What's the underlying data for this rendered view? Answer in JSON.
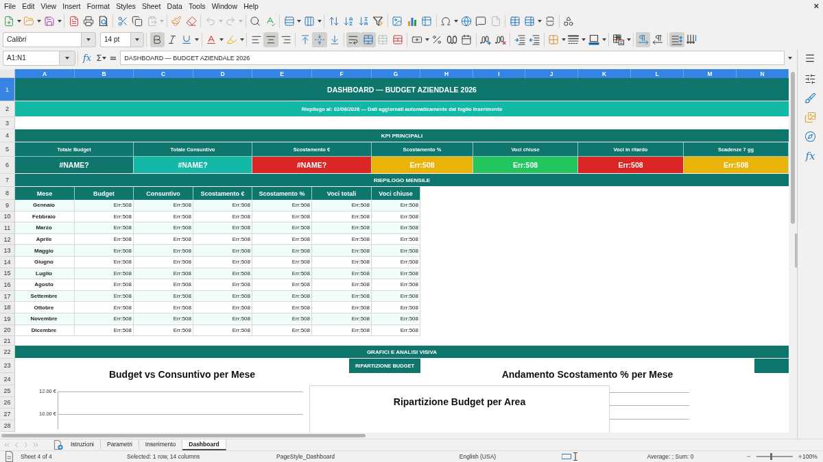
{
  "menu_bar": {
    "items": [
      "File",
      "Edit",
      "View",
      "Insert",
      "Format",
      "Styles",
      "Sheet",
      "Data",
      "Tools",
      "Window",
      "Help"
    ],
    "close_glyph": "×"
  },
  "toolbars": [
    {
      "groups": [
        {
          "items": [
            {
              "kind": "new",
              "dropdown": true,
              "active": false,
              "disabled": false
            },
            {
              "kind": "open",
              "dropdown": true,
              "active": false,
              "disabled": false
            },
            {
              "kind": "save",
              "dropdown": true,
              "active": false,
              "disabled": false
            }
          ]
        },
        {
          "items": [
            {
              "kind": "export_pdf",
              "dropdown": false,
              "active": false,
              "disabled": false
            },
            {
              "kind": "print",
              "dropdown": false,
              "active": false,
              "disabled": false
            },
            {
              "kind": "print_preview",
              "dropdown": false,
              "active": false,
              "disabled": false
            }
          ]
        },
        {
          "items": [
            {
              "kind": "cut",
              "dropdown": false,
              "active": false,
              "disabled": false
            },
            {
              "kind": "copy",
              "dropdown": false,
              "active": false,
              "disabled": false
            },
            {
              "kind": "paste",
              "dropdown": true,
              "active": false,
              "disabled": true
            }
          ]
        },
        {
          "items": [
            {
              "kind": "clone_formatting",
              "dropdown": false,
              "active": false,
              "disabled": false
            },
            {
              "kind": "clear_formatting",
              "dropdown": false,
              "active": false,
              "disabled": false
            }
          ]
        },
        {
          "items": [
            {
              "kind": "undo",
              "dropdown": true,
              "active": false,
              "disabled": true
            },
            {
              "kind": "redo",
              "dropdown": true,
              "active": false,
              "disabled": true
            }
          ]
        },
        {
          "items": [
            {
              "kind": "find_replace",
              "dropdown": false,
              "active": false,
              "disabled": false
            },
            {
              "kind": "spelling",
              "dropdown": false,
              "active": false,
              "disabled": false
            }
          ]
        },
        {
          "items": [
            {
              "kind": "row",
              "dropdown": true,
              "active": false,
              "disabled": false
            },
            {
              "kind": "column",
              "dropdown": true,
              "active": false,
              "disabled": false
            }
          ]
        },
        {
          "items": [
            {
              "kind": "sort",
              "dropdown": false,
              "active": false,
              "disabled": false
            },
            {
              "kind": "sort_ascending",
              "dropdown": false,
              "active": false,
              "disabled": false
            },
            {
              "kind": "sort_descending",
              "dropdown": false,
              "active": false,
              "disabled": false
            },
            {
              "kind": "autofilter",
              "dropdown": false,
              "active": false,
              "disabled": false
            }
          ]
        },
        {
          "items": [
            {
              "kind": "image",
              "dropdown": false,
              "active": false,
              "disabled": false
            },
            {
              "kind": "chart",
              "dropdown": false,
              "active": false,
              "disabled": false
            },
            {
              "kind": "pivot_table",
              "dropdown": false,
              "active": false,
              "disabled": false
            }
          ]
        },
        {
          "items": [
            {
              "kind": "special_character",
              "dropdown": true,
              "active": false,
              "disabled": false
            },
            {
              "kind": "hyperlink",
              "dropdown": false,
              "active": false,
              "disabled": false
            },
            {
              "kind": "comment",
              "dropdown": false,
              "active": false,
              "disabled": false
            },
            {
              "kind": "header_footer",
              "dropdown": false,
              "active": false,
              "disabled": true
            }
          ]
        },
        {
          "items": [
            {
              "kind": "print_area",
              "dropdown": false,
              "active": false,
              "disabled": false
            },
            {
              "kind": "freeze",
              "dropdown": true,
              "active": false,
              "disabled": false
            },
            {
              "kind": "split_window",
              "dropdown": false,
              "active": false,
              "disabled": false
            }
          ]
        },
        {
          "items": [
            {
              "kind": "draw_functions",
              "dropdown": false,
              "active": false,
              "disabled": false
            }
          ]
        }
      ]
    },
    {
      "font_name": "Calibri",
      "font_size": "14 pt",
      "groups": [
        {
          "items": [
            {
              "kind": "bold",
              "dropdown": false,
              "active": true,
              "disabled": false
            },
            {
              "kind": "italic",
              "dropdown": false,
              "active": false,
              "disabled": false
            },
            {
              "kind": "underline",
              "dropdown": true,
              "active": false,
              "disabled": false
            }
          ]
        },
        {
          "items": [
            {
              "kind": "font_color",
              "dropdown": true,
              "active": false,
              "disabled": false
            },
            {
              "kind": "highlight",
              "dropdown": true,
              "active": false,
              "disabled": false
            }
          ]
        },
        {
          "items": [
            {
              "kind": "align_left",
              "dropdown": false,
              "active": false,
              "disabled": false
            },
            {
              "kind": "align_center",
              "dropdown": false,
              "active": true,
              "disabled": false
            },
            {
              "kind": "align_right",
              "dropdown": false,
              "active": false,
              "disabled": false
            }
          ]
        },
        {
          "items": [
            {
              "kind": "align_top",
              "dropdown": false,
              "active": false,
              "disabled": false
            },
            {
              "kind": "align_middle",
              "dropdown": false,
              "active": true,
              "disabled": false
            },
            {
              "kind": "align_bottom",
              "dropdown": false,
              "active": false,
              "disabled": false
            }
          ]
        },
        {
          "items": [
            {
              "kind": "wrap_text",
              "dropdown": false,
              "active": true,
              "disabled": false
            },
            {
              "kind": "merge_center",
              "dropdown": false,
              "active": true,
              "disabled": false
            },
            {
              "kind": "merge",
              "dropdown": false,
              "active": false,
              "disabled": true
            },
            {
              "kind": "unmerge",
              "dropdown": false,
              "active": false,
              "disabled": false
            }
          ]
        },
        {
          "items": [
            {
              "kind": "currency",
              "dropdown": true,
              "active": false,
              "disabled": false
            },
            {
              "kind": "percent",
              "dropdown": false,
              "active": false,
              "disabled": false
            },
            {
              "kind": "number",
              "dropdown": false,
              "active": false,
              "disabled": false
            },
            {
              "kind": "date",
              "dropdown": false,
              "active": false,
              "disabled": false
            }
          ]
        },
        {
          "items": [
            {
              "kind": "add_decimal",
              "dropdown": false,
              "active": false,
              "disabled": false
            },
            {
              "kind": "delete_decimal",
              "dropdown": false,
              "active": false,
              "disabled": false
            }
          ]
        },
        {
          "items": [
            {
              "kind": "indent",
              "dropdown": false,
              "active": false,
              "disabled": false
            },
            {
              "kind": "outdent",
              "dropdown": false,
              "active": false,
              "disabled": false
            }
          ]
        },
        {
          "items": [
            {
              "kind": "borders",
              "dropdown": true,
              "active": false,
              "disabled": false
            },
            {
              "kind": "border_style",
              "dropdown": true,
              "active": false,
              "disabled": false
            },
            {
              "kind": "border_color",
              "dropdown": true,
              "active": false,
              "disabled": false
            }
          ]
        },
        {
          "items": [
            {
              "kind": "conditional",
              "dropdown": true,
              "active": false,
              "disabled": false
            }
          ]
        },
        {
          "items": [
            {
              "kind": "left_to_right",
              "dropdown": false,
              "active": true,
              "disabled": false
            },
            {
              "kind": "right_to_left",
              "dropdown": false,
              "active": false,
              "disabled": false
            }
          ]
        },
        {
          "items": [
            {
              "kind": "text_direction",
              "dropdown": false,
              "active": true,
              "disabled": false
            },
            {
              "kind": "vertical_text",
              "dropdown": false,
              "active": false,
              "disabled": false
            }
          ]
        }
      ]
    }
  ],
  "formula_bar": {
    "name_box": "A1:N1",
    "function_glyph": "fx",
    "sum_glyph": "Σ",
    "equals_glyph": "=",
    "content": "DASHBOARD — BUDGET AZIENDALE 2026"
  },
  "sheet": {
    "columns": [
      {
        "label": "A",
        "selected": true
      },
      {
        "label": "B",
        "selected": true
      },
      {
        "label": "C",
        "selected": true
      },
      {
        "label": "D",
        "selected": true
      },
      {
        "label": "E",
        "selected": true
      },
      {
        "label": "F",
        "selected": true
      },
      {
        "label": "G",
        "selected": true
      },
      {
        "label": "H",
        "selected": true
      },
      {
        "label": "I",
        "selected": true
      },
      {
        "label": "J",
        "selected": true
      },
      {
        "label": "K",
        "selected": true
      },
      {
        "label": "L",
        "selected": true
      },
      {
        "label": "M",
        "selected": true
      },
      {
        "label": "N",
        "selected": true
      }
    ],
    "rows": [
      {
        "number": "1",
        "selected": true,
        "kind": "title",
        "cells": [
          "DASHBOARD — BUDGET AZIENDALE 2026"
        ]
      },
      {
        "number": "2",
        "selected": false,
        "kind": "subtitle",
        "cells": [
          "Riepilogo al: 02/06/2026 — Dati aggiornati automaticamente dal foglio Inserimento"
        ]
      },
      {
        "number": "3",
        "selected": false,
        "kind": "blank"
      },
      {
        "number": "4",
        "selected": false,
        "kind": "section",
        "cells": [
          "KPI PRINCIPALI"
        ]
      },
      {
        "number": "5",
        "selected": false,
        "kind": "kpi_labels",
        "cells": [
          "Totale Budget",
          "Totale Consuntivo",
          "Scostamento €",
          "Scostamento %",
          "Voci chiuse",
          "Voci in ritardo",
          "Scadenze 7 gg"
        ]
      },
      {
        "number": "6",
        "selected": false,
        "kind": "kpi_values",
        "cells": [
          {
            "text": "#NAME?",
            "color": "#0f766e"
          },
          {
            "text": "#NAME?",
            "color": "#14b8a6"
          },
          {
            "text": "#NAME?",
            "color": "#dc2626"
          },
          {
            "text": "Err:508",
            "color": "#eab308"
          },
          {
            "text": "Err:508",
            "color": "#22c55e"
          },
          {
            "text": "Err:508",
            "color": "#dc2626"
          },
          {
            "text": "Err:508",
            "color": "#eab308"
          }
        ]
      },
      {
        "number": "7",
        "selected": false,
        "kind": "section",
        "cells": [
          "RIEPILOGO MENSILE"
        ]
      },
      {
        "number": "8",
        "selected": false,
        "kind": "table_header",
        "cells": [
          "Mese",
          "Budget",
          "Consuntivo",
          "Scostamento €",
          "Scostamento %",
          "Voci totali",
          "Voci chiuse"
        ]
      },
      {
        "number": "9",
        "selected": false,
        "kind": "table_row",
        "cells": [
          "Gennaio",
          "Err:508",
          "Err:508",
          "Err:508",
          "Err:508",
          "Err:508",
          "Err:508"
        ]
      },
      {
        "number": "10",
        "selected": false,
        "kind": "table_row",
        "cells": [
          "Febbraio",
          "Err:508",
          "Err:508",
          "Err:508",
          "Err:508",
          "Err:508",
          "Err:508"
        ]
      },
      {
        "number": "11",
        "selected": false,
        "kind": "table_row",
        "cells": [
          "Marzo",
          "Err:508",
          "Err:508",
          "Err:508",
          "Err:508",
          "Err:508",
          "Err:508"
        ]
      },
      {
        "number": "12",
        "selected": false,
        "kind": "table_row",
        "cells": [
          "Aprile",
          "Err:508",
          "Err:508",
          "Err:508",
          "Err:508",
          "Err:508",
          "Err:508"
        ]
      },
      {
        "number": "13",
        "selected": false,
        "kind": "table_row",
        "cells": [
          "Maggio",
          "Err:508",
          "Err:508",
          "Err:508",
          "Err:508",
          "Err:508",
          "Err:508"
        ]
      },
      {
        "number": "14",
        "selected": false,
        "kind": "table_row",
        "cells": [
          "Giugno",
          "Err:508",
          "Err:508",
          "Err:508",
          "Err:508",
          "Err:508",
          "Err:508"
        ]
      },
      {
        "number": "15",
        "selected": false,
        "kind": "table_row",
        "cells": [
          "Luglio",
          "Err:508",
          "Err:508",
          "Err:508",
          "Err:508",
          "Err:508",
          "Err:508"
        ]
      },
      {
        "number": "16",
        "selected": false,
        "kind": "table_row",
        "cells": [
          "Agosto",
          "Err:508",
          "Err:508",
          "Err:508",
          "Err:508",
          "Err:508",
          "Err:508"
        ]
      },
      {
        "number": "17",
        "selected": false,
        "kind": "table_row",
        "cells": [
          "Settembre",
          "Err:508",
          "Err:508",
          "Err:508",
          "Err:508",
          "Err:508",
          "Err:508"
        ]
      },
      {
        "number": "18",
        "selected": false,
        "kind": "table_row",
        "cells": [
          "Ottobre",
          "Err:508",
          "Err:508",
          "Err:508",
          "Err:508",
          "Err:508",
          "Err:508"
        ]
      },
      {
        "number": "19",
        "selected": false,
        "kind": "table_row",
        "cells": [
          "Novembre",
          "Err:508",
          "Err:508",
          "Err:508",
          "Err:508",
          "Err:508",
          "Err:508"
        ]
      },
      {
        "number": "20",
        "selected": false,
        "kind": "table_row",
        "cells": [
          "Dicembre",
          "Err:508",
          "Err:508",
          "Err:508",
          "Err:508",
          "Err:508",
          "Err:508"
        ]
      },
      {
        "number": "21",
        "selected": false,
        "kind": "blank"
      },
      {
        "number": "22",
        "selected": false,
        "kind": "section",
        "cells": [
          "GRAFICI E ANALISI VISIVA"
        ]
      },
      {
        "number": "23",
        "selected": false,
        "kind": "chart_label",
        "cells": [
          "RIPARTIZIONE BUDGET"
        ]
      },
      {
        "number": "24",
        "selected": false,
        "kind": "blank"
      },
      {
        "number": "25",
        "selected": false,
        "kind": "blank"
      },
      {
        "number": "26",
        "selected": false,
        "kind": "blank"
      },
      {
        "number": "27",
        "selected": false,
        "kind": "blank"
      },
      {
        "number": "28",
        "selected": false,
        "kind": "blank"
      }
    ],
    "charts": [
      {
        "kind": "axis",
        "title": "Budget vs Consuntivo per Mese",
        "y_tick_labels": [
          "12.00 €",
          "10.00 €"
        ]
      },
      {
        "kind": "lines",
        "title": "Andamento Scostamento % per Mese"
      },
      {
        "kind": "plain",
        "title": "Ripartizione Budget per Area"
      }
    ]
  },
  "sidebar": {
    "functions_glyph": "fx"
  },
  "sheet_tabs": [
    {
      "label": "Istruzioni",
      "selected": false
    },
    {
      "label": "Parametri",
      "selected": false
    },
    {
      "label": "Inserimento",
      "selected": false
    },
    {
      "label": "Dashboard",
      "selected": true
    }
  ],
  "status_bar": {
    "sheet_position": "Sheet 4 of 4",
    "selection": "Selected: 1 row, 14 columns",
    "page_style": "PageStyle_Dashboard",
    "language": "English (USA)",
    "summary": "Average: ; Sum: 0",
    "zoom": {
      "level": 0.4,
      "reading": "100%"
    }
  }
}
